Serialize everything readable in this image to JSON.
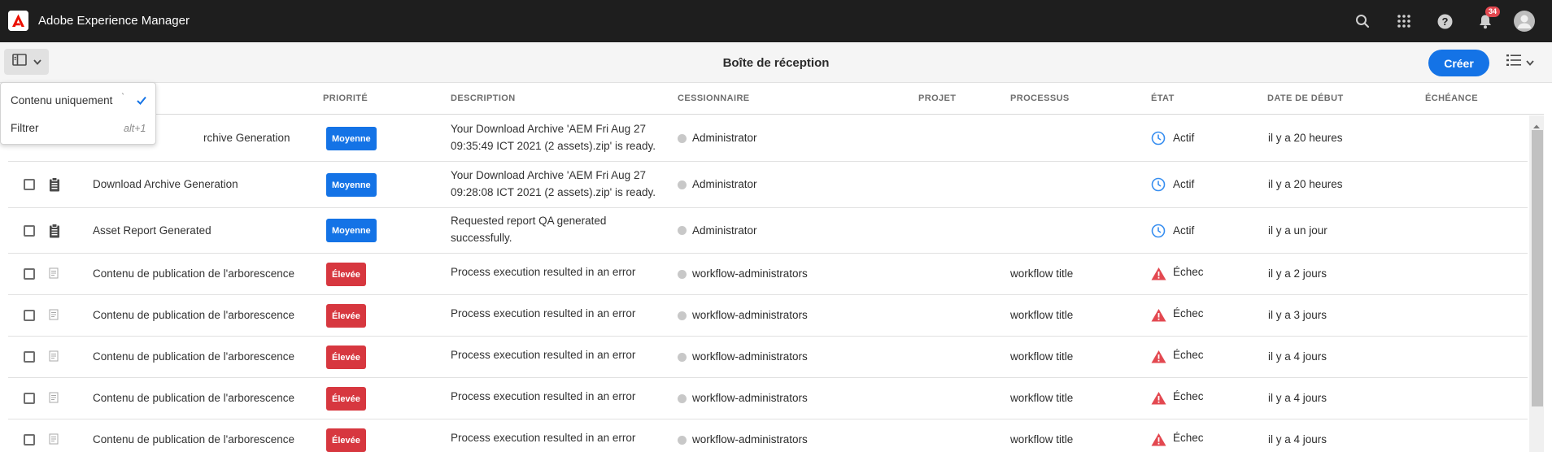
{
  "app": {
    "title": "Adobe Experience Manager"
  },
  "shell": {
    "notifications_count": "34",
    "icons": [
      "search-icon",
      "apps-grid-icon",
      "help-icon",
      "bell-icon",
      "user-avatar-icon"
    ]
  },
  "actionbar": {
    "page_title": "Boîte de réception",
    "create_label": "Créer"
  },
  "popover": {
    "items": [
      {
        "label": "Contenu uniquement",
        "shortcut": "`",
        "checked": true
      },
      {
        "label": "Filtrer",
        "shortcut": "alt+1",
        "checked": false
      }
    ]
  },
  "table": {
    "headers": [
      "Priorité",
      "Description",
      "Cessionnaire",
      "Projet",
      "Processus",
      "État",
      "Date de début",
      "Échéance"
    ],
    "rows": [
      {
        "title": "Download Archive Generation",
        "visible_title": "rchive Generation",
        "priority": "Moyenne",
        "description_line1": "Your Download Archive 'AEM Fri Aug 27",
        "description_line2": "09:35:49 ICT 2021 (2 assets).zip' is ready.",
        "assignee": "Administrator",
        "process": "",
        "state": "Actif",
        "start": "il y a 20 heures"
      },
      {
        "title": "Download Archive Generation",
        "priority": "Moyenne",
        "description_line1": "Your Download Archive 'AEM Fri Aug 27",
        "description_line2": "09:28:08 ICT 2021 (2 assets).zip' is ready.",
        "assignee": "Administrator",
        "process": "",
        "state": "Actif",
        "start": "il y a 20 heures"
      },
      {
        "title": "Asset Report Generated",
        "priority": "Moyenne",
        "description_line1": "Requested report QA generated",
        "description_line2": "successfully.",
        "assignee": "Administrator",
        "process": "",
        "state": "Actif",
        "start": "il y a un jour"
      },
      {
        "title": "Contenu de publication de l'arborescence",
        "priority": "Élevée",
        "description_line1": "Process execution resulted in an error",
        "description_line2": "",
        "assignee": "workflow-administrators",
        "process": "workflow title",
        "state": "Échec",
        "start": "il y a 2 jours"
      },
      {
        "title": "Contenu de publication de l'arborescence",
        "priority": "Élevée",
        "description_line1": "Process execution resulted in an error",
        "description_line2": "",
        "assignee": "workflow-administrators",
        "process": "workflow title",
        "state": "Échec",
        "start": "il y a 3 jours"
      },
      {
        "title": "Contenu de publication de l'arborescence",
        "priority": "Élevée",
        "description_line1": "Process execution resulted in an error",
        "description_line2": "",
        "assignee": "workflow-administrators",
        "process": "workflow title",
        "state": "Échec",
        "start": "il y a 4 jours"
      },
      {
        "title": "Contenu de publication de l'arborescence",
        "priority": "Élevée",
        "description_line1": "Process execution resulted in an error",
        "description_line2": "",
        "assignee": "workflow-administrators",
        "process": "workflow title",
        "state": "Échec",
        "start": "il y a 4 jours"
      },
      {
        "title": "Contenu de publication de l'arborescence",
        "priority": "Élevée",
        "description_line1": "Process execution resulted in an error",
        "description_line2": "",
        "assignee": "workflow-administrators",
        "process": "workflow title",
        "state": "Échec",
        "start": "il y a 4 jours"
      }
    ]
  },
  "colors": {
    "shell_bg": "#1e1e1e",
    "accent": "#1473e6",
    "priority_medium": "#1473e6",
    "priority_high": "#d7373f",
    "state_active": "#378ef0",
    "state_failed": "#e34850"
  }
}
